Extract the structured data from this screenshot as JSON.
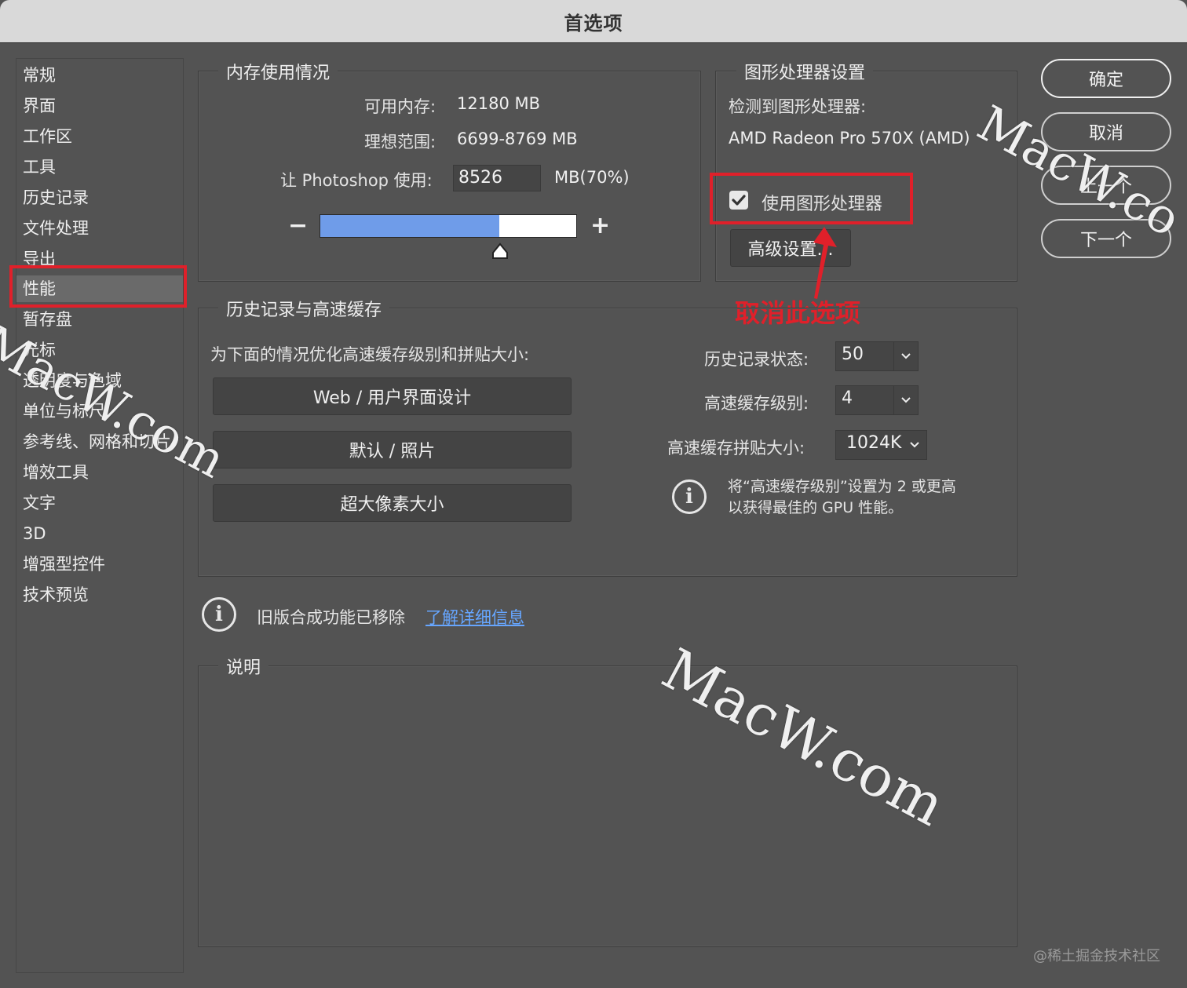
{
  "window": {
    "title": "首选项"
  },
  "sidebar": {
    "items": [
      {
        "label": "常规"
      },
      {
        "label": "界面"
      },
      {
        "label": "工作区"
      },
      {
        "label": "工具"
      },
      {
        "label": "历史记录"
      },
      {
        "label": "文件处理"
      },
      {
        "label": "导出"
      },
      {
        "label": "性能",
        "selected": true
      },
      {
        "label": "暂存盘"
      },
      {
        "label": "光标"
      },
      {
        "label": "透明度与色域"
      },
      {
        "label": "单位与标尺"
      },
      {
        "label": "参考线、网格和切片"
      },
      {
        "label": "增效工具"
      },
      {
        "label": "文字"
      },
      {
        "label": "3D"
      },
      {
        "label": "增强型控件"
      },
      {
        "label": "技术预览"
      }
    ]
  },
  "memory": {
    "title": "内存使用情况",
    "available_label": "可用内存:",
    "available_value": "12180 MB",
    "ideal_label": "理想范围:",
    "ideal_value": "6699-8769 MB",
    "use_label": "让 Photoshop 使用:",
    "use_value": "8526",
    "use_unit": "MB(70%)",
    "minus": "−",
    "plus": "+",
    "slider_percent": 70
  },
  "gpu": {
    "title": "图形处理器设置",
    "detected_label": "检测到图形处理器:",
    "detected_value": "AMD Radeon Pro 570X (AMD)",
    "use_gpu_label": "使用图形处理器",
    "use_gpu_checked": true,
    "advanced_label": "高级设置..."
  },
  "actions": {
    "ok": "确定",
    "cancel": "取消",
    "prev": "上一个",
    "next": "下一个"
  },
  "cache": {
    "title": "历史记录与高速缓存",
    "optimize_label": "为下面的情况优化高速缓存级别和拼贴大小:",
    "preset_web": "Web / 用户界面设计",
    "preset_default": "默认 / 照片",
    "preset_huge": "超大像素大小",
    "history_label": "历史记录状态:",
    "history_value": "50",
    "levels_label": "高速缓存级别:",
    "levels_value": "4",
    "tile_label": "高速缓存拼贴大小:",
    "tile_value": "1024K",
    "tip_line1": "将“高速缓存级别”设置为 2 或更高",
    "tip_line2": "以获得最佳的 GPU 性能。"
  },
  "legacy": {
    "text": "旧版合成功能已移除",
    "link": "了解详细信息"
  },
  "description": {
    "title": "说明"
  },
  "annotation": {
    "text": "取消此选项",
    "color": "#e0202a"
  },
  "watermarks": {
    "mark1": "MacW.co",
    "mark2": "MacW.com",
    "mark3": "MacW.com",
    "footer": "@稀土掘金技术社区"
  },
  "icons": {
    "info": "info-icon",
    "check": "checkmark-icon",
    "dropdown": "chevron-down-icon",
    "slider_thumb": "triangle-thumb-icon"
  }
}
